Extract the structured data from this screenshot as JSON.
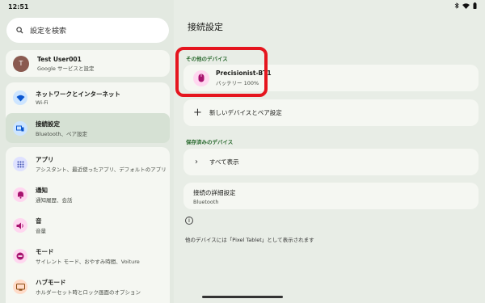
{
  "status": {
    "time": "12:51"
  },
  "search": {
    "placeholder": "設定を検索"
  },
  "account": {
    "initial": "T",
    "name": "Test User001",
    "sub": "Google サービスと設定"
  },
  "menu": [
    {
      "name": "ネットワークとインターネット",
      "sub": "Wi-Fi",
      "icon": "wifi-icon",
      "color": "#cde5ff"
    },
    {
      "name": "接続設定",
      "sub": "Bluetooth、ペア設定",
      "icon": "connected-devices-icon",
      "color": "#cde5ff"
    },
    {
      "name": "アプリ",
      "sub": "アシスタント、最近使ったアプリ、デフォルトのアプリ",
      "icon": "apps-icon",
      "color": "#dfe2ff"
    },
    {
      "name": "通知",
      "sub": "通知履歴、会話",
      "icon": "bell-icon",
      "color": "#ffd7f0"
    },
    {
      "name": "音",
      "sub": "音量",
      "icon": "sound-icon",
      "color": "#ffd7f0"
    },
    {
      "name": "モード",
      "sub": "サイレント モード、おやすみ時間、Voiture",
      "icon": "mode-icon",
      "color": "#ffd7f0"
    },
    {
      "name": "ハブモード",
      "sub": "ホルダーセット時とロック画面のオプション",
      "icon": "hub-icon",
      "color": "#ffdbc8"
    }
  ],
  "main": {
    "title": "接続設定",
    "other_devices": "その他のデバイス",
    "device": {
      "name": "Precisionist-BT1",
      "battery": "バッテリー 100%"
    },
    "pair_new": "新しいデバイスとペア設定",
    "saved_devices": "保存済みのデバイス",
    "show_all": "すべて表示",
    "prefs": {
      "title": "接続の詳細設定",
      "sub": "Bluetooth"
    },
    "info_text": "他のデバイスには「Pixel Tablet」として表示されます"
  }
}
